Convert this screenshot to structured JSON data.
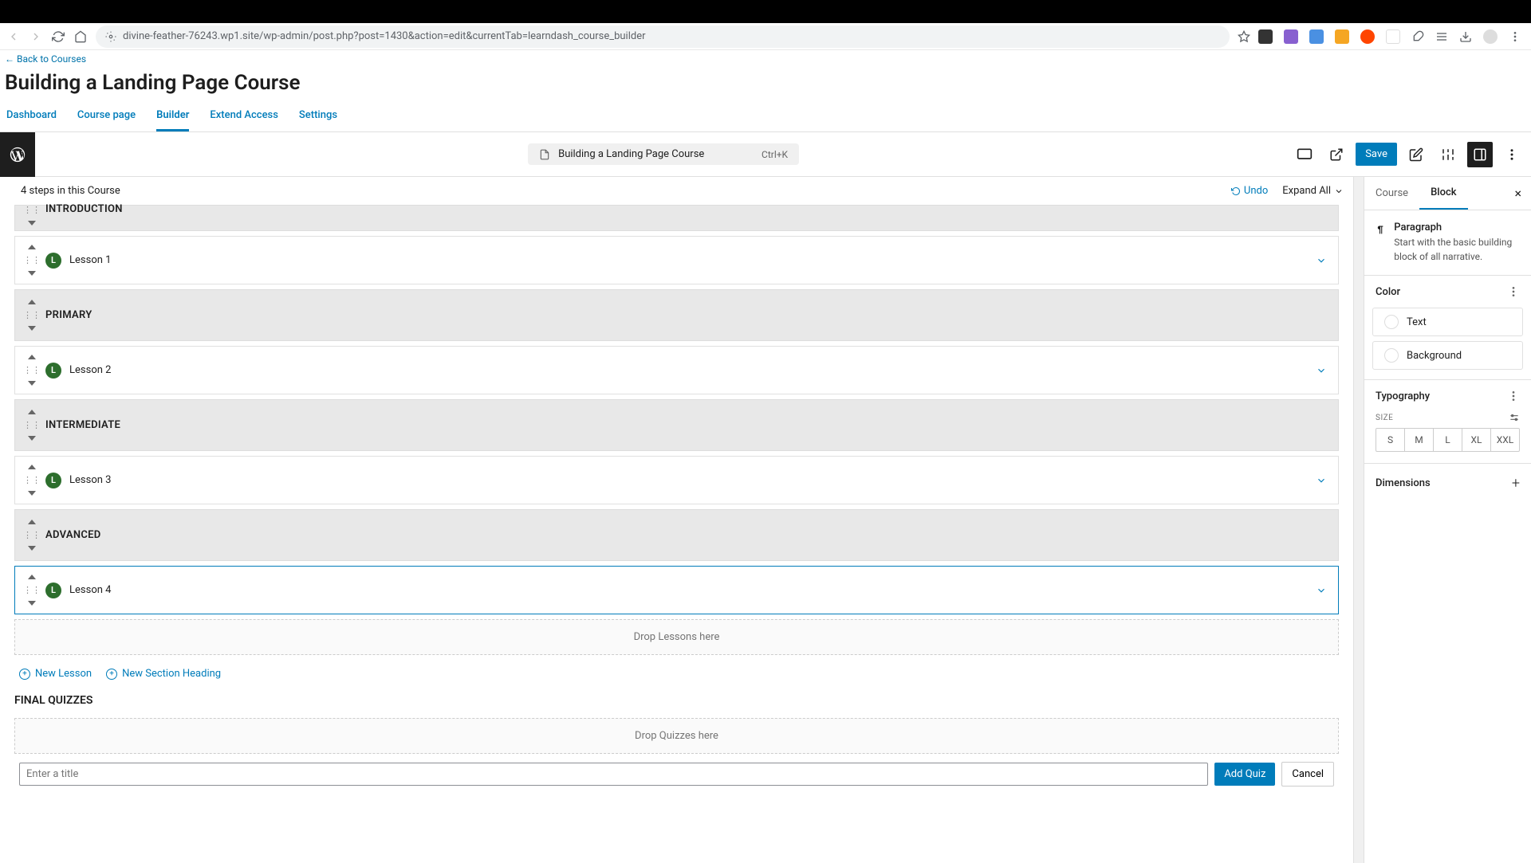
{
  "browser": {
    "url": "divine-feather-76243.wp1.site/wp-admin/post.php?post=1430&action=edit&currentTab=learndash_course_builder"
  },
  "back_link": "← Back to Courses",
  "page_title": "Building a Landing Page Course",
  "tabs": [
    "Dashboard",
    "Course page",
    "Builder",
    "Extend Access",
    "Settings"
  ],
  "active_tab": "Builder",
  "editor": {
    "search_label": "Building a Landing Page Course",
    "shortcut": "Ctrl+K",
    "save": "Save"
  },
  "builder": {
    "steps_label": "4 steps in this Course",
    "undo": "Undo",
    "expand": "Expand All",
    "sections": [
      {
        "type": "section",
        "title": "INTRODUCTION",
        "partial": true
      },
      {
        "type": "lesson",
        "title": "Lesson 1"
      },
      {
        "type": "section",
        "title": "PRIMARY"
      },
      {
        "type": "lesson",
        "title": "Lesson 2"
      },
      {
        "type": "section",
        "title": "INTERMEDIATE"
      },
      {
        "type": "lesson",
        "title": "Lesson 3"
      },
      {
        "type": "section",
        "title": "ADVANCED"
      },
      {
        "type": "lesson",
        "title": "Lesson 4",
        "selected": true
      }
    ],
    "drop_lessons": "Drop Lessons here",
    "new_lesson": "New Lesson",
    "new_section": "New Section Heading",
    "final_quizzes": "FINAL QUIZZES",
    "drop_quizzes": "Drop Quizzes here",
    "quiz_placeholder": "Enter a title",
    "add_quiz": "Add Quiz",
    "cancel": "Cancel"
  },
  "sidebar": {
    "tabs": [
      "Course",
      "Block"
    ],
    "active": "Block",
    "block_name": "Paragraph",
    "block_desc": "Start with the basic building block of all narrative.",
    "color_label": "Color",
    "text_label": "Text",
    "background_label": "Background",
    "typography_label": "Typography",
    "size_label": "SIZE",
    "sizes": [
      "S",
      "M",
      "L",
      "XL",
      "XXL"
    ],
    "dimensions_label": "Dimensions"
  }
}
